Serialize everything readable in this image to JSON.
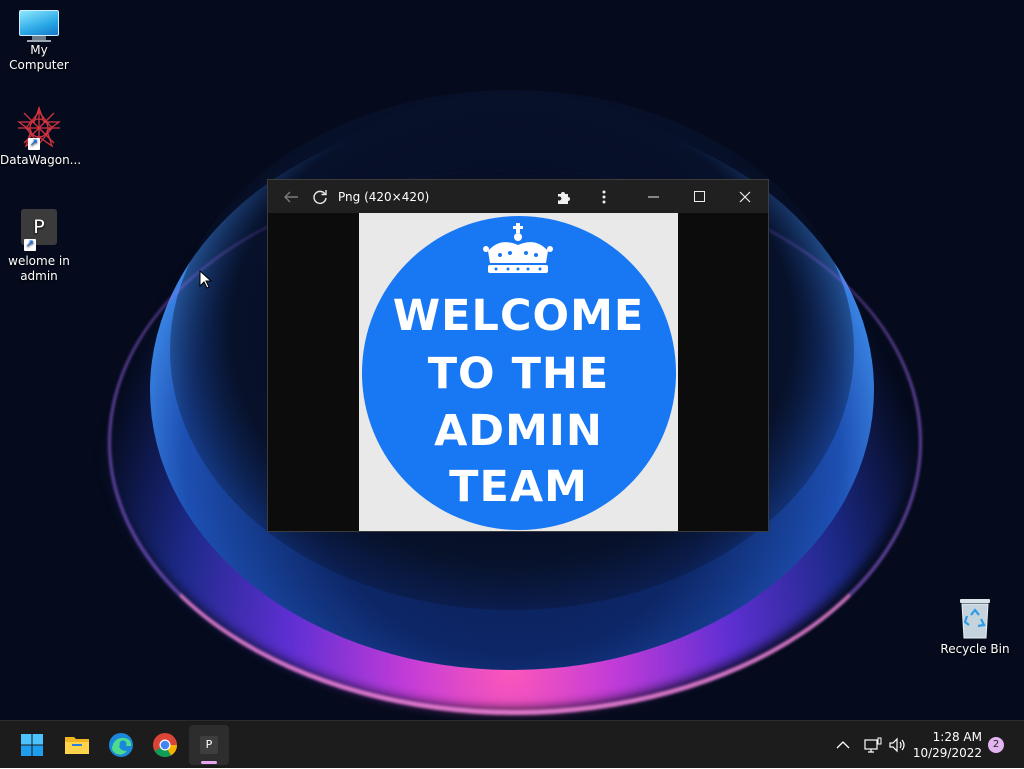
{
  "desktop": {
    "icons": [
      {
        "label": "My Computer",
        "icon": "computer-icon"
      },
      {
        "label": "DataWagon...",
        "icon": "datawagon-icon"
      },
      {
        "label": "welome in admin",
        "icon": "p-shortcut-icon",
        "glyph": "P"
      },
      {
        "label": "Recycle Bin",
        "icon": "recycle-bin-icon"
      }
    ]
  },
  "window": {
    "title": "Png (420×420)",
    "image_lines": [
      "WELCOME",
      "TO THE",
      "ADMIN",
      "TEAM"
    ],
    "image_colors": {
      "circle": "#1877f2",
      "background": "#e9e9e9"
    }
  },
  "taskbar": {
    "apps": [
      {
        "name": "start-button",
        "icon": "windows-logo-icon"
      },
      {
        "name": "file-explorer",
        "icon": "folder-icon"
      },
      {
        "name": "edge",
        "icon": "edge-icon"
      },
      {
        "name": "chrome",
        "icon": "chrome-icon"
      },
      {
        "name": "p-app",
        "icon": "p-app-icon",
        "glyph": "P",
        "active": true
      }
    ],
    "clock": {
      "time": "1:28 AM",
      "date": "10/29/2022"
    },
    "notification_count": "2"
  },
  "colors": {
    "accent": "#e8a6f0",
    "taskbar": "#1c1c1c",
    "titlebar": "#202020"
  }
}
